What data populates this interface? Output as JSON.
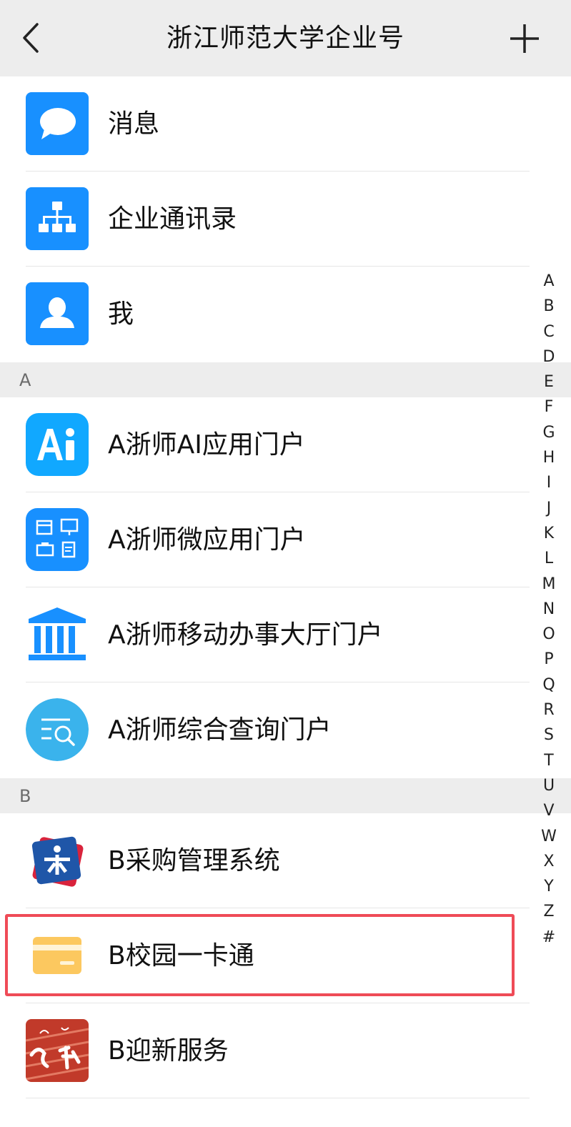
{
  "header": {
    "title": "浙江师范大学企业号",
    "back_icon": "chevron-left-icon",
    "add_icon": "plus-icon"
  },
  "fixed_items": [
    {
      "label": "消息",
      "icon": "chat-bubble-icon",
      "icon_color": "#1890ff"
    },
    {
      "label": "企业通讯录",
      "icon": "org-chart-icon",
      "icon_color": "#1890ff"
    },
    {
      "label": "我",
      "icon": "person-icon",
      "icon_color": "#1890ff"
    }
  ],
  "sections": [
    {
      "letter": "A",
      "items": [
        {
          "label": "A浙师AI应用门户",
          "icon": "ai-icon"
        },
        {
          "label": "A浙师微应用门户",
          "icon": "micro-apps-icon"
        },
        {
          "label": "A浙师移动办事大厅门户",
          "icon": "government-building-icon"
        },
        {
          "label": "A浙师综合查询门户",
          "icon": "search-list-icon"
        }
      ]
    },
    {
      "letter": "B",
      "items": [
        {
          "label": "B采购管理系统",
          "icon": "procurement-logo-icon"
        },
        {
          "label": "B校园一卡通",
          "icon": "card-icon"
        },
        {
          "label": "B迎新服务",
          "icon": "welcome-photo-icon"
        }
      ]
    }
  ],
  "index_letters": [
    "A",
    "B",
    "C",
    "D",
    "E",
    "F",
    "G",
    "H",
    "I",
    "J",
    "K",
    "L",
    "M",
    "N",
    "O",
    "P",
    "Q",
    "R",
    "S",
    "T",
    "U",
    "V",
    "W",
    "X",
    "Y",
    "Z",
    "#"
  ],
  "colors": {
    "accent_blue": "#1890ff",
    "highlight_red": "#ef4b57",
    "card_yellow": "#fcc85f"
  }
}
